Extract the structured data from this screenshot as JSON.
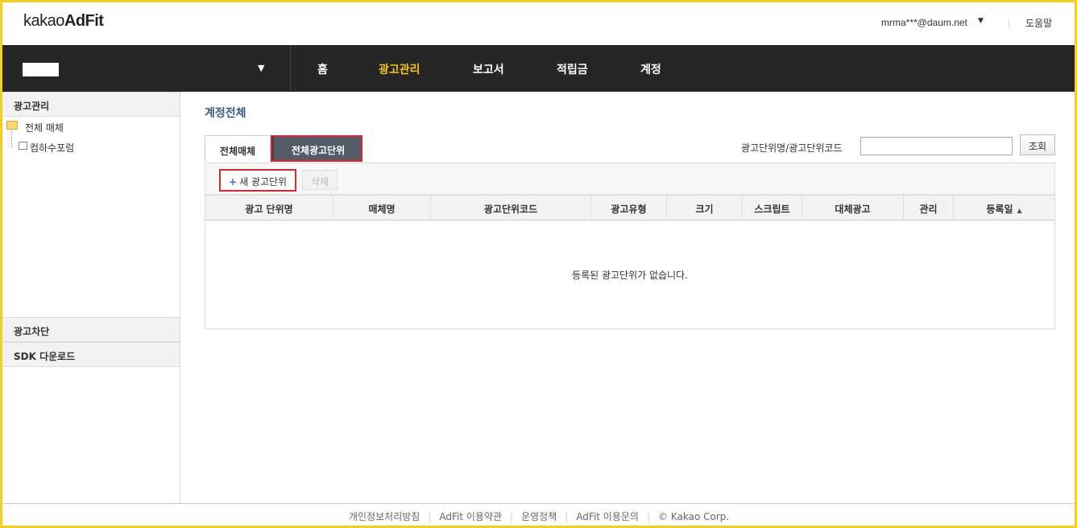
{
  "header": {
    "logo_light": "kakao",
    "logo_bold": "AdFit",
    "user_email": "mrma***@daum.net",
    "help_label": "도움말"
  },
  "navbar": {
    "items": [
      {
        "label": "홈",
        "active": false
      },
      {
        "label": "광고관리",
        "active": true
      },
      {
        "label": "보고서",
        "active": false
      },
      {
        "label": "적립금",
        "active": false
      },
      {
        "label": "계정",
        "active": false
      }
    ],
    "active_color": "#f5c518"
  },
  "sidebar": {
    "section_ad_management": "광고관리",
    "tree_all_media": "전체 매체",
    "tree_child": "컴하수포럼",
    "section_ad_block": "광고차단",
    "section_sdk": "SDK 다운로드"
  },
  "main": {
    "page_title": "계정전체",
    "tabs": [
      {
        "label": "전체매체",
        "selected": false
      },
      {
        "label": "전체광고단위",
        "selected": true
      }
    ],
    "search": {
      "label": "광고단위명/광고단위코드",
      "value": "",
      "button_label": "조회"
    },
    "toolbar": {
      "new_plus": "+",
      "new_label": "새 광고단위",
      "delete_label": "삭제"
    },
    "table": {
      "columns": [
        "광고 단위명",
        "매체명",
        "광고단위코드",
        "광고유형",
        "크기",
        "스크립트",
        "대체광고",
        "관리",
        "등록일"
      ],
      "sort_column": "등록일",
      "sort_direction": "ascending",
      "sort_icon": "▲",
      "empty_message": "등록된 광고단위가 없습니다."
    }
  },
  "footer": {
    "links": [
      "개인정보처리방침",
      "AdFit 이용약관",
      "운영정책",
      "AdFit 이용문의"
    ],
    "copyright": "© Kakao Corp."
  },
  "colors": {
    "frame_border": "#f4cf1f",
    "navbar_bg": "#262626",
    "highlight_red": "#d9272e",
    "title_blue": "#3e5a84"
  }
}
